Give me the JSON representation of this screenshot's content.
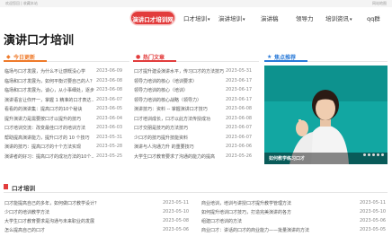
{
  "topbar": {
    "left": "欢迎您回 | 收藏本站",
    "right": "网站地图"
  },
  "nav": {
    "items": [
      {
        "label": "演讲口才培训网"
      },
      {
        "label": "口才培训"
      },
      {
        "label": "演讲培训"
      },
      {
        "label": "演讲稿"
      },
      {
        "label": "领导力"
      },
      {
        "label": "培训资讯"
      },
      {
        "label": "qq群"
      }
    ]
  },
  "logo": "演讲口才培训",
  "columns": {
    "latest": {
      "title": "今日更新",
      "rows": [
        {
          "title": "临场与口才发展，为什么不让感慨没心学",
          "date": "2023-06-09"
        },
        {
          "title": "临场和口才发展为，如何平衡讨要自己的人？",
          "date": "2023-06-08"
        },
        {
          "title": "临场和口才发展为，谈心，从小事细处，逐步...",
          "date": "2023-06-08"
        },
        {
          "title": "演讲语言让你开一，掌握 1 精准的口才表达...",
          "date": "2023-06-07"
        },
        {
          "title": "看看的的演讲集：提高口才的10个秘诀",
          "date": "2023-06-05"
        },
        {
          "title": "提升演讲力是需要按口才以提升的技巧",
          "date": "2023-06-04"
        },
        {
          "title": "口才培训交流：改变最佳口才的培训方法",
          "date": "2023-06-03"
        },
        {
          "title": "帮助提高演讲能力，提升口才的 10 个技巧",
          "date": "2023-05-31"
        },
        {
          "title": "演讲的技巧：提高口才的十个方法实现",
          "date": "2023-05-28"
        },
        {
          "title": "演讲者的好习：提高口才的成功方法的10个...",
          "date": "2023-05-25"
        }
      ]
    },
    "hot": {
      "title": "热门文章",
      "rows": [
        {
          "title": "口才提升建设演讲水平，传习口才的方法技巧",
          "date": "2023-05-31"
        },
        {
          "title": "领导力培训的核心（培训要求）",
          "date": "2023-06-17"
        },
        {
          "title": "领导力培训的核心（培训）",
          "date": "2023-06-17"
        },
        {
          "title": "领导力培训的核心战略（领导力）",
          "date": "2023-06-17"
        },
        {
          "title": "演讲技巧：资料 -- 掌握演讲口才技巧",
          "date": "2023-06-08"
        },
        {
          "title": "口才培训成长，口才以此方法传授成功",
          "date": "2023-06-08"
        },
        {
          "title": "口才交朋是技巧的方法技巧",
          "date": "2023-06-07"
        },
        {
          "title": "少口才的技巧提升技能资料",
          "date": "2023-06-07"
        },
        {
          "title": "演讲与人沟通力升 的重要技巧",
          "date": "2023-06-06"
        },
        {
          "title": "大学生口才教育要求了沟通的能力的提高",
          "date": "2023-05-26"
        }
      ]
    },
    "focus": {
      "title": "焦点推荐",
      "caption": "如何教学练习口才"
    }
  },
  "bottom": {
    "title": "口才培训",
    "left": [
      {
        "title": "口才能提高自己的多年，如何做口才教学设计？",
        "date": "2023-05-11"
      },
      {
        "title": "少口才的培训教学方法",
        "date": "2023-05-10"
      },
      {
        "title": "大学生口才教育要求是沟通与未来职业的发展",
        "date": "2023-05-08"
      },
      {
        "title": "怎么提高自己的口才",
        "date": "2023-05-06"
      }
    ],
    "right": [
      {
        "title": "商业培训，培训与讲授口才提升教学管理方法",
        "date": "2023-05-11"
      },
      {
        "title": "如何提升培训口才技巧，打造完美演讲的各方",
        "date": "2023-05-10"
      },
      {
        "title": "组建口才培训的方法",
        "date": "2023-05-06"
      },
      {
        "title": "商业口才：讲话的口才的商业能力——批量演讲的方法",
        "date": "2023-05-05"
      }
    ]
  },
  "colors": {
    "accent": "#e23c3c",
    "blue": "#2a7ad8",
    "orange": "#ef7a2a"
  }
}
